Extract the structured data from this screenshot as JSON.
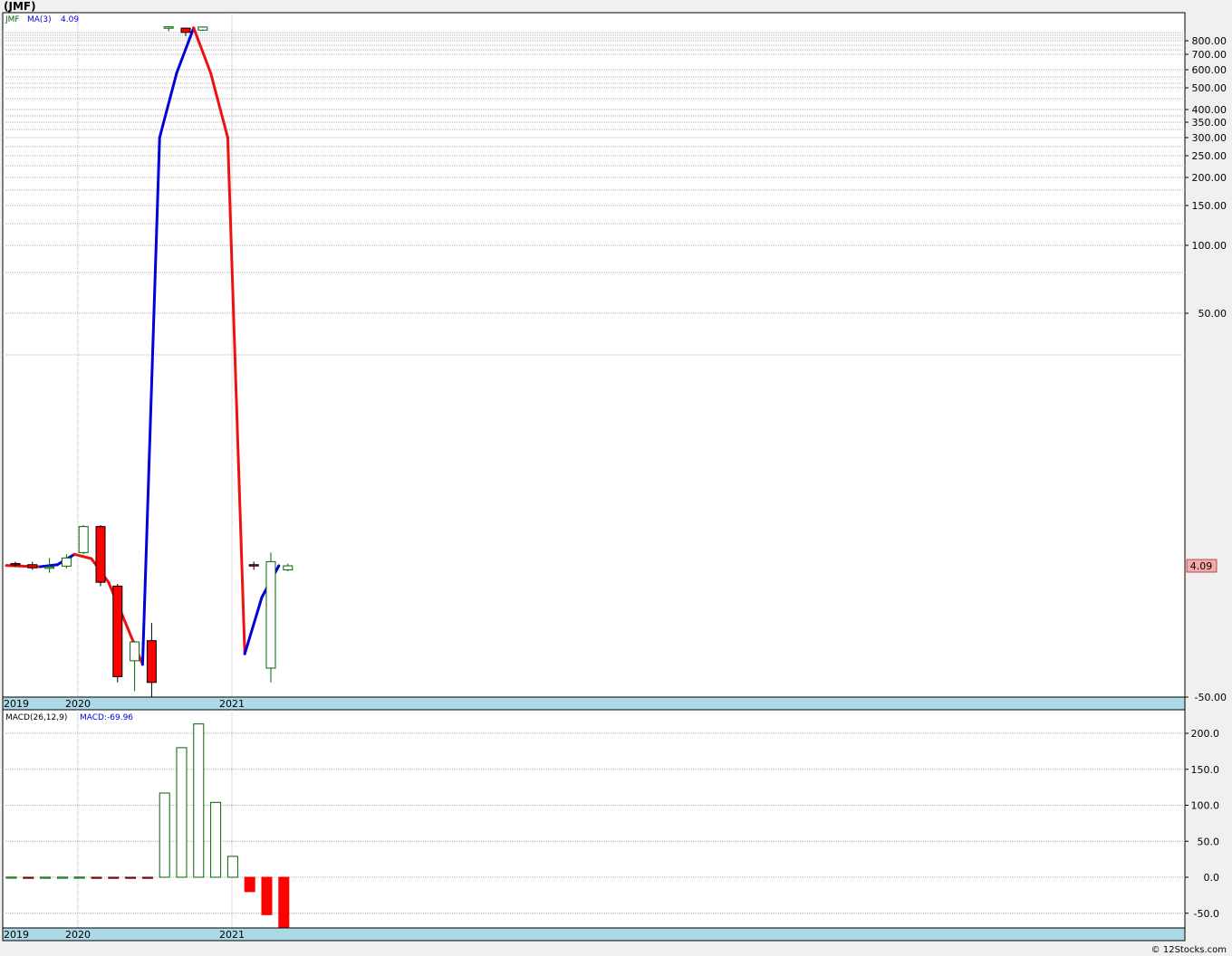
{
  "title": "(JMF)",
  "footer": "© 12Stocks.com",
  "colors": {
    "up": "#006400",
    "down": "#ff0000",
    "ma_up": "#0000dd",
    "ma_down": "#ee1111",
    "grid": "#b4b4b4",
    "date_band": "#add8e6",
    "price_badge": "#f4aaaa"
  },
  "chart_data": [
    {
      "type": "candlestick",
      "period": "monthly",
      "scale": "log",
      "grid": true,
      "legend": {
        "symbol": "JMF",
        "ma_label": "MA(3)",
        "ma_value": "4.09"
      },
      "last_price_label": "4.09",
      "y_ticks": [
        "800.00",
        "700.00",
        "600.00",
        "500.00",
        "400.00",
        "350.00",
        "300.00",
        "250.00",
        "200.00",
        "150.00",
        "100.00",
        "50.00",
        "-50.00"
      ],
      "x_labels": [
        "2019",
        "2020",
        "2021"
      ],
      "candles": [
        {
          "open": 4.15,
          "high": 4.2,
          "low": 4.05,
          "close": 4.12
        },
        {
          "open": 4.12,
          "high": 4.2,
          "low": 3.95,
          "close": 4.02
        },
        {
          "open": 4.05,
          "high": 4.3,
          "low": 3.85,
          "close": 4.05
        },
        {
          "open": 4.08,
          "high": 4.4,
          "low": 4.0,
          "close": 4.3
        },
        {
          "open": 4.45,
          "high": 5.3,
          "low": 4.4,
          "close": 5.25
        },
        {
          "open": 5.25,
          "high": 5.3,
          "low": 3.45,
          "close": 3.55
        },
        {
          "open": 3.45,
          "high": 3.5,
          "low": 1.95,
          "close": 1.97
        },
        {
          "open": 2.1,
          "high": 2.4,
          "low": 1.92,
          "close": 2.38
        },
        {
          "open": 2.4,
          "high": 2.7,
          "low": 1.9,
          "close": 1.95
        },
        {
          "open": 860,
          "high": 875,
          "low": 840,
          "close": 870
        },
        {
          "open": 858,
          "high": 862,
          "low": 820,
          "close": 835
        },
        {
          "open": 845,
          "high": 875,
          "low": 842,
          "close": 868
        },
        {
          "open": 4.12,
          "high": 4.2,
          "low": 3.95,
          "close": 4.1
        },
        {
          "open": 2.0,
          "high": 4.45,
          "low": 1.95,
          "close": 4.2
        },
        {
          "open": 3.95,
          "high": 4.15,
          "low": 3.9,
          "close": 4.09
        }
      ],
      "ma": [
        4.1,
        4.08,
        4.06,
        4.12,
        4.4,
        4.28,
        3.55,
        2.7,
        2.05,
        300,
        580,
        860,
        580,
        300,
        2.2,
        3.2,
        4.09
      ]
    },
    {
      "type": "bar",
      "legend": {
        "label": "MACD(26,12,9)",
        "value_label": "MACD:-69.96"
      },
      "y_ticks": [
        "200.0",
        "150.0",
        "100.0",
        "50.0",
        "0.0",
        "-50.0"
      ],
      "ylim": [
        -70,
        225
      ],
      "x_labels": [
        "2019",
        "2020",
        "2021"
      ],
      "values": [
        0.2,
        -0.1,
        0.1,
        0.15,
        0.2,
        -0.2,
        -0.5,
        -0.6,
        -0.7,
        117,
        180,
        213,
        104,
        29,
        -20,
        -52,
        -69.96
      ]
    }
  ]
}
